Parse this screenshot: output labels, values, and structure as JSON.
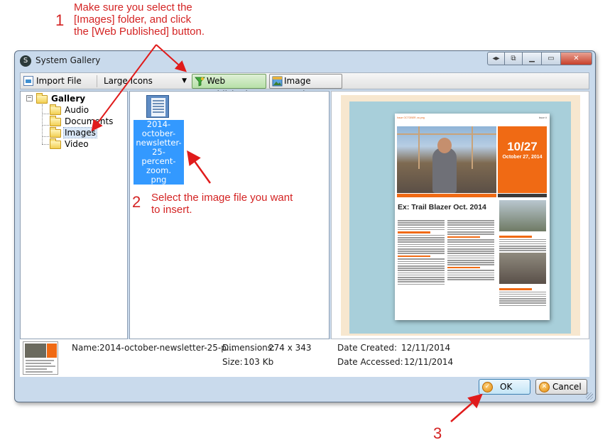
{
  "annotations": [
    {
      "number": "1",
      "text": "Make sure you select the\n[Images] folder, and click\nthe [Web Published] button."
    },
    {
      "number": "2",
      "text": "Select the image file you want\nto insert."
    },
    {
      "number": "3",
      "text": ""
    }
  ],
  "window": {
    "title": "System Gallery",
    "controls": [
      "swap-icon",
      "minimize-to-tray-icon",
      "minimize-icon",
      "maximize-icon",
      "close-icon"
    ]
  },
  "toolbar": {
    "import_label": "Import File",
    "view_mode": "Large Icons",
    "web_published_label": "Web Published",
    "image_preview_label": "Image Preview"
  },
  "tree": {
    "root": "Gallery",
    "children": [
      "Audio",
      "Documents",
      "Images",
      "Video"
    ],
    "selected": "Images"
  },
  "file": {
    "caption": "2014-october-newsletter-25-percent-zoom.png",
    "caption_lines": [
      "2014-october-",
      "newsletter-25-",
      "percent-zoom.",
      "png"
    ]
  },
  "preview": {
    "header_left": "Issue OCTOBER, ss.png",
    "header_right": "Issue #",
    "date_big": "10/27",
    "date_full": "October 27, 2014",
    "headline": "Ex: Trail Blazer Oct. 2014",
    "colors": {
      "accent": "#f06a14",
      "backdrop": "#a8cfda",
      "frame": "#f7e7cf"
    }
  },
  "info": {
    "name_label": "Name:",
    "name_value": "2014-october-newsletter-25-p...",
    "dimensions_label": "Dimensions:",
    "dimensions_value": "274 x 343",
    "size_label": "Size:",
    "size_value": "103 Kb",
    "created_label": "Date Created:",
    "created_value": "12/11/2014",
    "accessed_label": "Date Accessed:",
    "accessed_value": "12/11/2014"
  },
  "buttons": {
    "ok": "OK",
    "cancel": "Cancel"
  }
}
